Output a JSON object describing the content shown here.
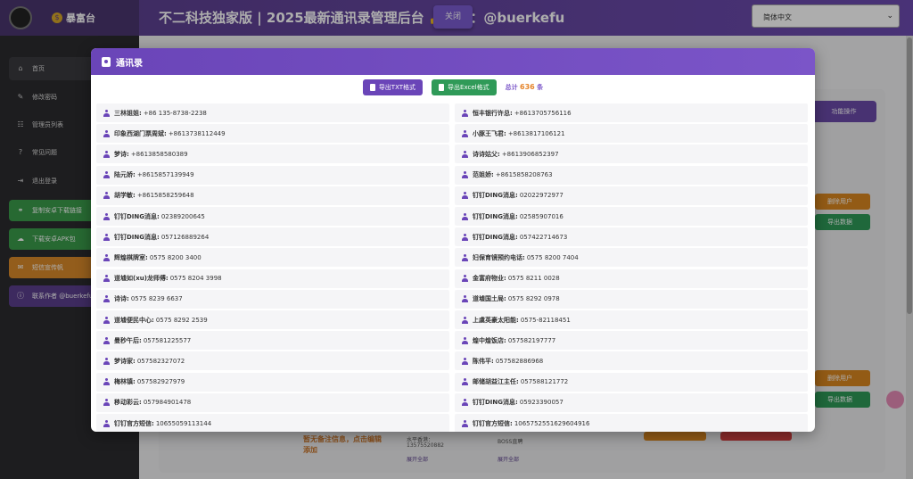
{
  "header": {
    "brand": "暴富台",
    "title": "不二科技独家版 | 2025最新通讯录管理后台 👍 TG：@buerkefu",
    "close_label": "关闭",
    "language": "简体中文"
  },
  "sidebar": {
    "items": [
      {
        "label": "首页",
        "icon": "home-icon"
      },
      {
        "label": "修改密码",
        "icon": "user-edit-icon"
      },
      {
        "label": "管理员列表",
        "icon": "users-icon"
      },
      {
        "label": "常见问题",
        "icon": "question-icon"
      },
      {
        "label": "退出登录",
        "icon": "logout-icon"
      }
    ],
    "buttons": [
      {
        "label": "复制安卓下载链接",
        "color": "#3a9b4a"
      },
      {
        "label": "下载安卓APK包",
        "color": "#3a9b4a"
      },
      {
        "label": "短信宣传帆",
        "color": "#d98a2a"
      },
      {
        "label": "联系作者 @buerkefu",
        "color": "#5b3f8c"
      }
    ]
  },
  "background": {
    "tab_label": "功能操作",
    "delete_user": "删除用户",
    "export_data": "导出数据",
    "note": "暂无备注信息，点击编辑添加",
    "phone_label": "水平香港：",
    "phone_number": "13575520882",
    "expand_all": "展开全部",
    "boss": "BOSS直聘"
  },
  "modal": {
    "title": "通讯录",
    "export_txt": "导出TXT格式",
    "export_excel": "导出Excel格式",
    "total_prefix": "总计",
    "total_count": "636",
    "total_suffix": "条",
    "contacts": [
      {
        "name": "三林姐姐:",
        "phone": "+86 135-8738-2238"
      },
      {
        "name": "恒丰银行许总:",
        "phone": "+8613705756116"
      },
      {
        "name": "印象西湖门票周斌:",
        "phone": "+8613738112449"
      },
      {
        "name": "小豚王飞君:",
        "phone": "+8613817106121"
      },
      {
        "name": "梦诗:",
        "phone": "+8613858580389"
      },
      {
        "name": "诗诗姑父:",
        "phone": "+8613906852397"
      },
      {
        "name": "陆元娇:",
        "phone": "+8615857139949"
      },
      {
        "name": "范姐娇:",
        "phone": "+8615858208763"
      },
      {
        "name": "胡学敏:",
        "phone": "+8615858259648"
      },
      {
        "name": "钉钉DING消息:",
        "phone": "02022972977"
      },
      {
        "name": "钉钉DING消息:",
        "phone": "02389200645"
      },
      {
        "name": "钉钉DING消息:",
        "phone": "02585907016"
      },
      {
        "name": "钉钉DING消息:",
        "phone": "057126889264"
      },
      {
        "name": "钉钉DING消息:",
        "phone": "057422714673"
      },
      {
        "name": "辉煌棋牌室:",
        "phone": "0575 8200 3400"
      },
      {
        "name": "妇保育镜预约电话:",
        "phone": "0575 8200 7404"
      },
      {
        "name": "道墟如(xu)龙师傅:",
        "phone": "0575 8204 3998"
      },
      {
        "name": "金富府物业:",
        "phone": "0575 8211 0028"
      },
      {
        "name": "诗诗:",
        "phone": "0575 8239 6637"
      },
      {
        "name": "道墟国土局:",
        "phone": "0575 8292 0978"
      },
      {
        "name": "道墟便民中心:",
        "phone": "0575 8292 2539"
      },
      {
        "name": "上虞英豪太阳能:",
        "phone": "0575-82118451"
      },
      {
        "name": "曼秒午后:",
        "phone": "057581225577"
      },
      {
        "name": "煌中煌饭店:",
        "phone": "057582197777"
      },
      {
        "name": "梦诗家:",
        "phone": "057582327072"
      },
      {
        "name": "陈伟平:",
        "phone": "057582886968"
      },
      {
        "name": "梅林镇:",
        "phone": "057582927979"
      },
      {
        "name": "邮储胡益江主任:",
        "phone": "057588121772"
      },
      {
        "name": "移动彩云:",
        "phone": "057984901478"
      },
      {
        "name": "钉钉DING消息:",
        "phone": "05923390057"
      },
      {
        "name": "钉钉官方短信:",
        "phone": "10655059113144"
      },
      {
        "name": "钉钉官方短信:",
        "phone": "1065752551629604916"
      }
    ]
  }
}
